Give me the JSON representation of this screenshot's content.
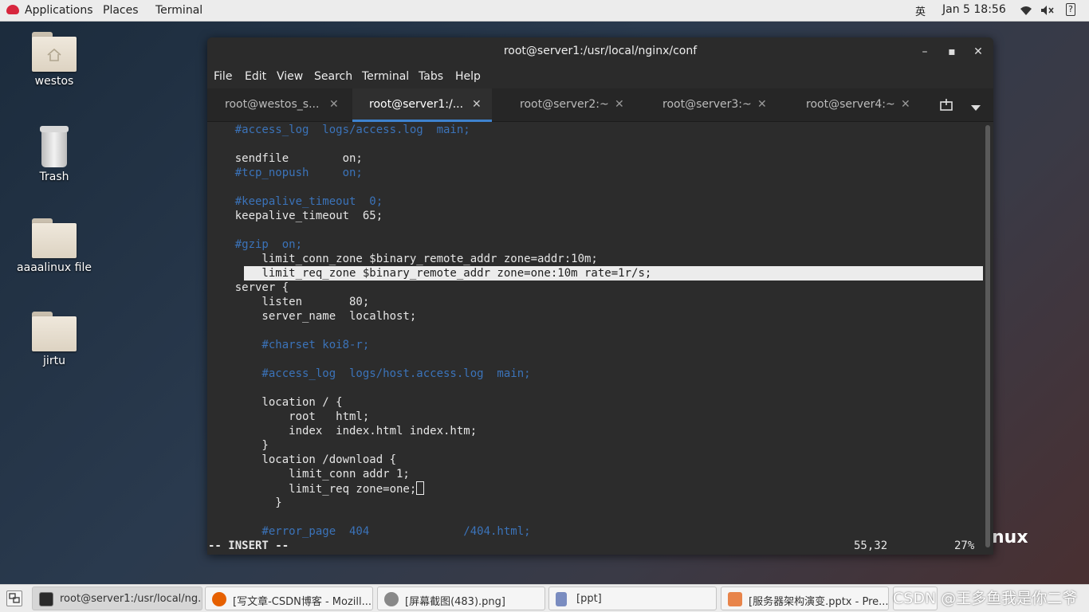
{
  "topbar": {
    "applications": "Applications",
    "places": "Places",
    "terminal": "Terminal",
    "ime": "英",
    "datetime": "Jan 5  18:56",
    "icons": [
      "wifi-icon",
      "volume-muted-icon",
      "help-icon"
    ],
    "help_glyph": "?"
  },
  "desktop": {
    "icons": [
      {
        "label": "westos",
        "type": "home-folder"
      },
      {
        "label": "Trash",
        "type": "trash"
      },
      {
        "label": "aaaalinux file",
        "type": "folder"
      },
      {
        "label": "jirtu",
        "type": "folder"
      }
    ],
    "distro_text": "nux"
  },
  "window": {
    "title": "root@server1:/usr/local/nginx/conf",
    "minimize": "–",
    "maximize": "▪",
    "close": "✕",
    "menu": [
      "File",
      "Edit",
      "View",
      "Search",
      "Terminal",
      "Tabs",
      "Help"
    ],
    "tabs": [
      {
        "label": "root@westos_s...",
        "close": "✕"
      },
      {
        "label": "root@server1:/...",
        "close": "✕"
      },
      {
        "label": "root@server2:~",
        "close": "✕"
      },
      {
        "label": "root@server3:~",
        "close": "✕"
      },
      {
        "label": "root@server4:~",
        "close": "✕"
      }
    ],
    "active_tab": 1,
    "terminal_lines": [
      "    #access_log  logs/access.log  main;",
      "",
      "    sendfile        on;",
      "    #tcp_nopush     on;",
      "",
      "    #keepalive_timeout  0;",
      "    keepalive_timeout  65;",
      "",
      "    #gzip  on;",
      "        limit_conn_zone $binary_remote_addr zone=addr:10m;",
      "        limit_req_zone $binary_remote_addr zone=one:10m rate=1r/s;",
      "    server {",
      "        listen       80;",
      "        server_name  localhost;",
      "",
      "        #charset koi8-r;",
      "",
      "        #access_log  logs/host.access.log  main;",
      "",
      "        location / {",
      "            root   html;",
      "            index  index.html index.htm;",
      "        }",
      "        location /download {",
      "            limit_conn addr 1;",
      "            limit_req zone=one;",
      "          }",
      "",
      "        #error_page  404              /404.html;"
    ],
    "status_mode": "-- INSERT --",
    "status_pos": "55,32",
    "status_pct": "27%"
  },
  "taskbar": {
    "items": [
      {
        "label": "root@server1:/usr/local/ng...",
        "icon": "terminal-icon",
        "color": "#2b2b2b"
      },
      {
        "label": "[写文章-CSDN博客 - Mozill...",
        "icon": "firefox-icon",
        "color": "#e66000"
      },
      {
        "label": "[屏幕截图(483).png]",
        "icon": "image-viewer-icon",
        "color": "#888888"
      },
      {
        "label": "[ppt]",
        "icon": "file-manager-icon",
        "color": "#7a8cc0"
      },
      {
        "label": "[服务器架构演变.pptx - Pre...",
        "icon": "presentation-icon",
        "color": "#e8844a"
      }
    ],
    "watermark": "CSDN @王多鱼我是你二爷"
  }
}
